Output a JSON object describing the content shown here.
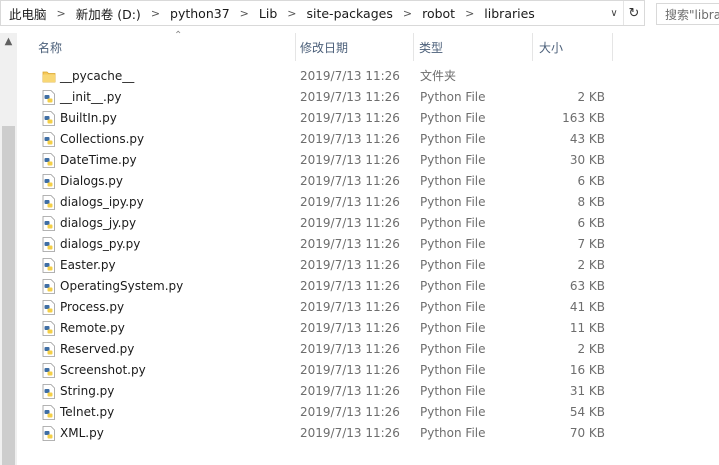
{
  "address_bar": {
    "crumbs": [
      "此电脑",
      "新加卷 (D:)",
      "python37",
      "Lib",
      "site-packages",
      "robot",
      "libraries"
    ]
  },
  "search": {
    "placeholder": "搜索\"libraries\""
  },
  "columns": {
    "name": "名称",
    "date": "修改日期",
    "type": "类型",
    "size": "大小"
  },
  "files": [
    {
      "name": "__pycache__",
      "date": "2019/7/13 11:26",
      "type": "文件夹",
      "size": "",
      "icon": "folder-icon"
    },
    {
      "name": "__init__.py",
      "date": "2019/7/13 11:26",
      "type": "Python File",
      "size": "2 KB",
      "icon": "python-file-icon"
    },
    {
      "name": "BuiltIn.py",
      "date": "2019/7/13 11:26",
      "type": "Python File",
      "size": "163 KB",
      "icon": "python-file-icon"
    },
    {
      "name": "Collections.py",
      "date": "2019/7/13 11:26",
      "type": "Python File",
      "size": "43 KB",
      "icon": "python-file-icon"
    },
    {
      "name": "DateTime.py",
      "date": "2019/7/13 11:26",
      "type": "Python File",
      "size": "30 KB",
      "icon": "python-file-icon"
    },
    {
      "name": "Dialogs.py",
      "date": "2019/7/13 11:26",
      "type": "Python File",
      "size": "6 KB",
      "icon": "python-file-icon"
    },
    {
      "name": "dialogs_ipy.py",
      "date": "2019/7/13 11:26",
      "type": "Python File",
      "size": "8 KB",
      "icon": "python-file-icon"
    },
    {
      "name": "dialogs_jy.py",
      "date": "2019/7/13 11:26",
      "type": "Python File",
      "size": "6 KB",
      "icon": "python-file-icon"
    },
    {
      "name": "dialogs_py.py",
      "date": "2019/7/13 11:26",
      "type": "Python File",
      "size": "7 KB",
      "icon": "python-file-icon"
    },
    {
      "name": "Easter.py",
      "date": "2019/7/13 11:26",
      "type": "Python File",
      "size": "2 KB",
      "icon": "python-file-icon"
    },
    {
      "name": "OperatingSystem.py",
      "date": "2019/7/13 11:26",
      "type": "Python File",
      "size": "63 KB",
      "icon": "python-file-icon"
    },
    {
      "name": "Process.py",
      "date": "2019/7/13 11:26",
      "type": "Python File",
      "size": "41 KB",
      "icon": "python-file-icon"
    },
    {
      "name": "Remote.py",
      "date": "2019/7/13 11:26",
      "type": "Python File",
      "size": "11 KB",
      "icon": "python-file-icon"
    },
    {
      "name": "Reserved.py",
      "date": "2019/7/13 11:26",
      "type": "Python File",
      "size": "2 KB",
      "icon": "python-file-icon"
    },
    {
      "name": "Screenshot.py",
      "date": "2019/7/13 11:26",
      "type": "Python File",
      "size": "16 KB",
      "icon": "python-file-icon"
    },
    {
      "name": "String.py",
      "date": "2019/7/13 11:26",
      "type": "Python File",
      "size": "31 KB",
      "icon": "python-file-icon"
    },
    {
      "name": "Telnet.py",
      "date": "2019/7/13 11:26",
      "type": "Python File",
      "size": "54 KB",
      "icon": "python-file-icon"
    },
    {
      "name": "XML.py",
      "date": "2019/7/13 11:26",
      "type": "Python File",
      "size": "70 KB",
      "icon": "python-file-icon"
    }
  ],
  "colors": {
    "header_text": "#4c607a",
    "folder": "#f5c75a",
    "python_blue": "#3f6ea5",
    "python_yellow": "#f4cf47"
  }
}
